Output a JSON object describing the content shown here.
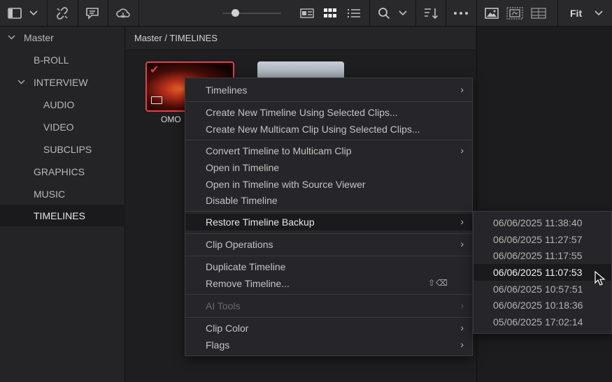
{
  "toolbar": {
    "icons": [
      "sidebar-toggle-icon",
      "chevron-down-icon",
      "unlink-icon",
      "comment-icon",
      "cloud-icon",
      "metadata-view-icon",
      "grid-view-icon",
      "list-view-icon",
      "search-icon",
      "sort-icon",
      "more-icon",
      "image-icon",
      "filmstrip-icon",
      "grid-split-icon"
    ],
    "fit_label": "Fit",
    "zoom_level": 0.22
  },
  "sidebar": {
    "items": [
      {
        "label": "Master",
        "indent": 0,
        "expanded": true,
        "selected": false
      },
      {
        "label": "B-ROLL",
        "indent": 1,
        "selected": false
      },
      {
        "label": "INTERVIEW",
        "indent": 1,
        "expanded": true,
        "selected": false
      },
      {
        "label": "AUDIO",
        "indent": 2,
        "selected": false
      },
      {
        "label": "VIDEO",
        "indent": 2,
        "selected": false
      },
      {
        "label": "SUBCLIPS",
        "indent": 2,
        "selected": false
      },
      {
        "label": "GRAPHICS",
        "indent": 1,
        "selected": false
      },
      {
        "label": "MUSIC",
        "indent": 1,
        "selected": false
      },
      {
        "label": "TIMELINES",
        "indent": 1,
        "selected": true
      }
    ]
  },
  "content": {
    "breadcrumb": "Master / TIMELINES",
    "clips": [
      {
        "label": "OMO",
        "selected": true
      },
      {
        "label": "",
        "selected": false
      }
    ]
  },
  "context_menu": {
    "groups": [
      [
        {
          "label": "Timelines",
          "submenu": true
        }
      ],
      [
        {
          "label": "Create New Timeline Using Selected Clips..."
        },
        {
          "label": "Create New Multicam Clip Using Selected Clips..."
        }
      ],
      [
        {
          "label": "Convert Timeline to Multicam Clip",
          "submenu": true
        },
        {
          "label": "Open in Timeline"
        },
        {
          "label": "Open in Timeline with Source Viewer"
        },
        {
          "label": "Disable Timeline"
        }
      ],
      [
        {
          "label": "Restore Timeline Backup",
          "submenu": true,
          "active": true
        }
      ],
      [
        {
          "label": "Clip Operations",
          "submenu": true
        }
      ],
      [
        {
          "label": "Duplicate Timeline"
        },
        {
          "label": "Remove Timeline...",
          "shortcut": "⇧⌫"
        }
      ],
      [
        {
          "label": "AI Tools",
          "submenu": true,
          "disabled": true
        }
      ],
      [
        {
          "label": "Clip Color",
          "submenu": true
        },
        {
          "label": "Flags",
          "submenu": true
        }
      ]
    ]
  },
  "backup_submenu": {
    "items": [
      "06/06/2025 11:38:40",
      "06/06/2025 11:27:57",
      "06/06/2025 11:17:55",
      "06/06/2025 11:07:53",
      "06/06/2025 10:57:51",
      "06/06/2025 10:18:36",
      "05/06/2025 17:02:14"
    ],
    "hovered_index": 3
  }
}
